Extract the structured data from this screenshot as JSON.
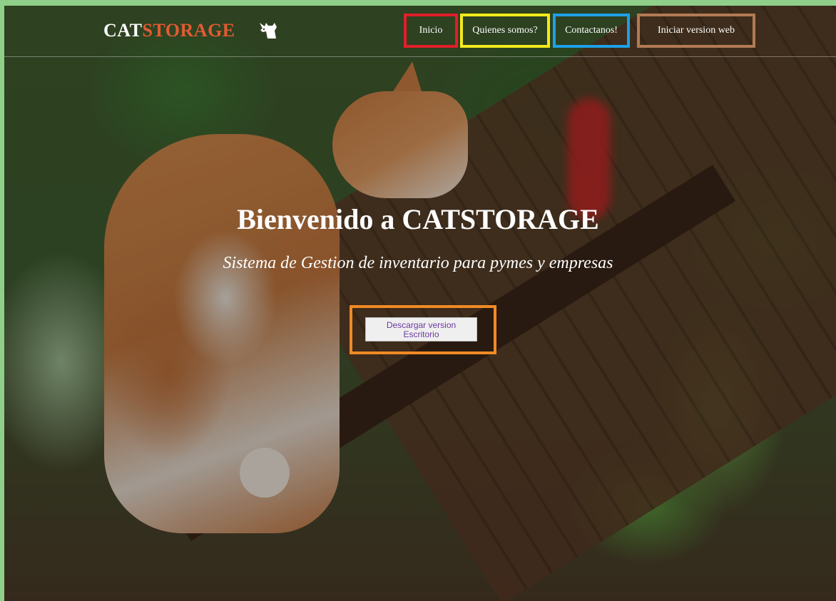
{
  "caption": {
    "partial_text": "...ge...p..."
  },
  "navbar": {
    "brand": {
      "prefix": "CAT",
      "suffix": "STORAGE",
      "prefix_color": "#ffffff",
      "suffix_color": "#e25a33",
      "icon": "cat-icon"
    },
    "items": [
      {
        "label": "Inicio",
        "highlight_color": "#e01f2a"
      },
      {
        "label": "Quienes somos?",
        "highlight_color": "#f2ea1c"
      },
      {
        "label": "Contactanos!",
        "highlight_color": "#1ea0e6"
      },
      {
        "label": "Iniciar version web",
        "highlight_color": "#b27a55"
      }
    ]
  },
  "hero": {
    "title": "Bienvenido a CATSTORAGE",
    "subtitle": "Sistema de Gestion de inventario para pymes y empresas",
    "download_button": {
      "label": "Descargar version Escritorio",
      "highlight_color": "#f08a25"
    }
  },
  "colors": {
    "frame_green": "#8fcf8a",
    "text": "#ffffff",
    "button_text": "#6b3aa0"
  }
}
